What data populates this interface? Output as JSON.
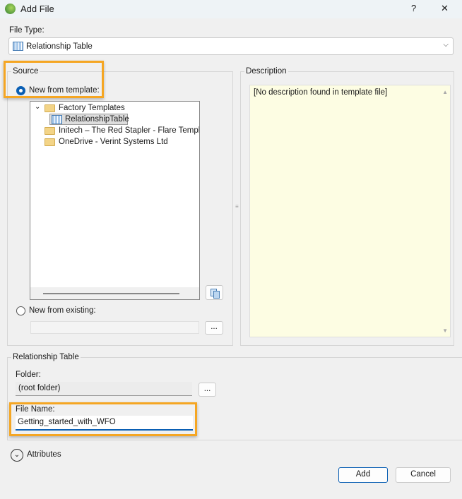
{
  "window": {
    "title": "Add File",
    "help": "?",
    "close": "✕"
  },
  "file_type": {
    "label": "File Type:",
    "value": "Relationship Table"
  },
  "source": {
    "label": "Source",
    "new_from_template": "New from template:",
    "tree": [
      {
        "label": "Factory Templates",
        "expanded": true,
        "children": [
          {
            "label": "RelationshipTable",
            "selected": true
          }
        ]
      },
      {
        "label": "Initech – The Red Stapler - Flare Templat"
      },
      {
        "label": "OneDrive - Verint Systems Ltd"
      }
    ],
    "new_from_existing": "New from existing:",
    "browse": "..."
  },
  "description": {
    "label": "Description",
    "text": "[No description found in template file]",
    "background": "#fdfde3"
  },
  "relationship_table": {
    "label": "Relationship Table",
    "folder_label": "Folder:",
    "folder_value": "(root folder)",
    "folder_browse": "...",
    "file_name_label": "File Name:",
    "file_name_value": "Getting_started_with_WFO"
  },
  "attributes": "Attributes",
  "buttons": {
    "add": "Add",
    "cancel": "Cancel"
  },
  "highlight_color": "#f5a623"
}
